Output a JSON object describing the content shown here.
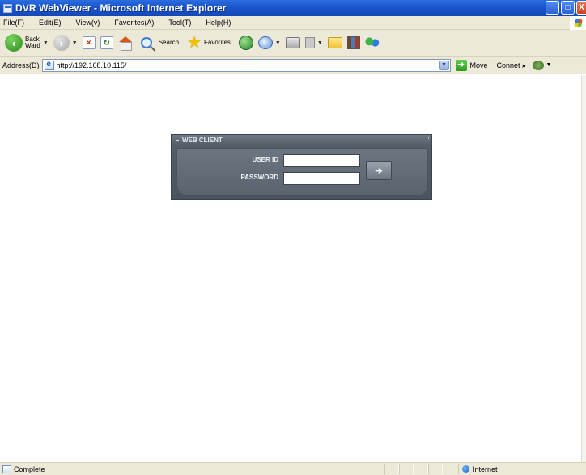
{
  "window": {
    "title": "DVR WebViewer - Microsoft Internet Explorer",
    "controls": {
      "minimize": "_",
      "maximize": "□",
      "close": "X"
    }
  },
  "menu": {
    "items": [
      "File(F)",
      "Edit(E)",
      "View(v)",
      "Favorites(A)",
      "Tool(T)",
      "Help(H)"
    ]
  },
  "toolbar": {
    "back_label_line1": "Back",
    "back_label_line2": "Ward",
    "search_label": "Search",
    "favorites_label": "Favorites"
  },
  "address": {
    "label": "Address(D)",
    "url": "http://192.168.10.115/",
    "go_label": "Move",
    "connect_label": "Connet",
    "more": "»"
  },
  "login": {
    "panel_title": "WEB CLIENT",
    "user_id_label": "USER ID",
    "password_label": "PASSWORD",
    "user_id_value": "",
    "password_value": "",
    "submit_glyph": "➔"
  },
  "status": {
    "text": "Complete",
    "zone": "Internet"
  },
  "colors": {
    "titlebar": "#1b55c9",
    "chrome": "#ece9d8",
    "panel": "#55606c"
  }
}
